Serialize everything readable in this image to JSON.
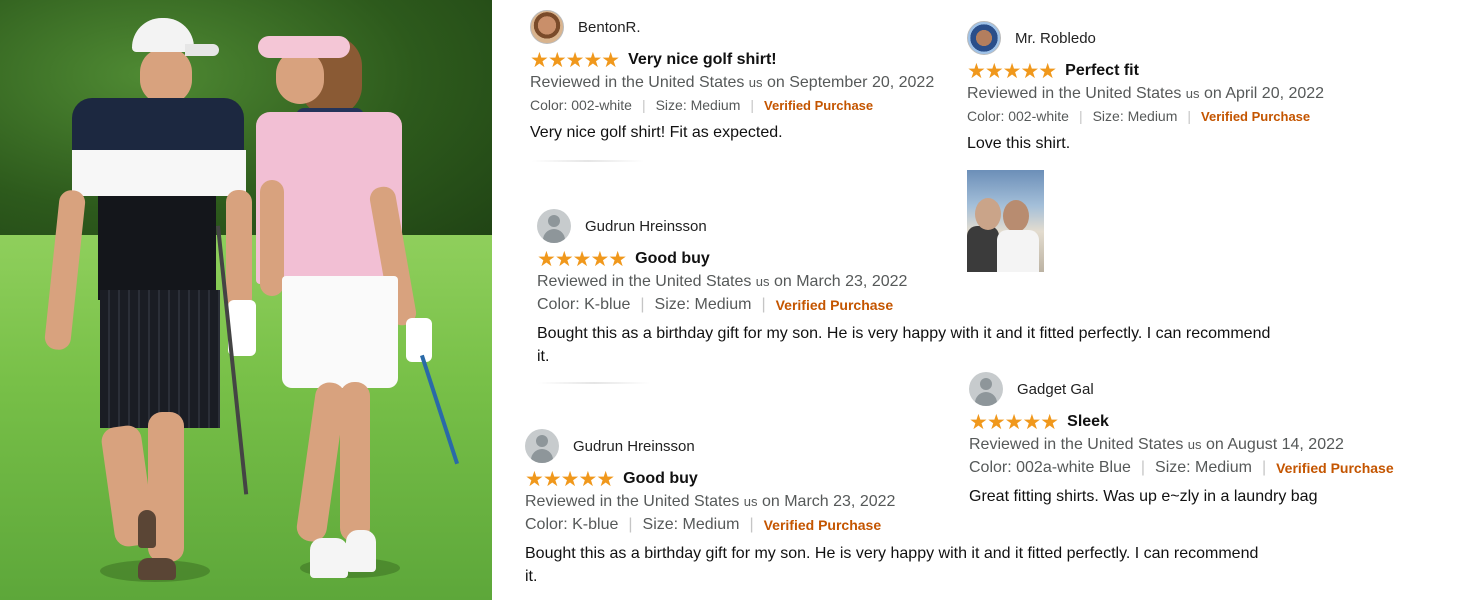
{
  "reviews": [
    {
      "reviewer": "BentonR.",
      "stars": "★★★★★",
      "title": "Very nice golf shirt!",
      "reviewed_prefix": "Reviewed in the United States",
      "flag": "us",
      "reviewed_date": "on September 20, 2022",
      "color": "Color: 002-white",
      "size": "Size: Medium",
      "verified": "Verified Purchase",
      "body": "Very nice golf shirt! Fit as expected."
    },
    {
      "reviewer": "Mr. Robledo",
      "stars": "★★★★★",
      "title": "Perfect fit",
      "reviewed_prefix": "Reviewed in the United States",
      "flag": "us",
      "reviewed_date": "on April 20, 2022",
      "color": "Color: 002-white",
      "size": "Size: Medium",
      "verified": "Verified Purchase",
      "body": "Love this shirt."
    },
    {
      "reviewer": "Gudrun Hreinsson",
      "stars": "★★★★★",
      "title": "Good buy",
      "reviewed_prefix": "Reviewed in the United States",
      "flag": "us",
      "reviewed_date": "on March 23, 2022",
      "color": "Color: K-blue",
      "size": "Size: Medium",
      "verified": "Verified Purchase",
      "body_line1": "Bought this as a birthday gift for my son. He is very happy with it and it fitted perfectly. I can recommend",
      "body_line2": "it."
    },
    {
      "reviewer": "Gadget Gal",
      "stars": "★★★★★",
      "title": "Sleek",
      "reviewed_prefix": "Reviewed in the United States",
      "flag": "us",
      "reviewed_date": "on August 14, 2022",
      "color": "Color: 002a-white Blue",
      "size": "Size: Medium",
      "verified": "Verified Purchase",
      "body": "Great fitting shirts. Was up e~zly in a laundry bag"
    },
    {
      "reviewer": "Gudrun Hreinsson",
      "stars": "★★★★★",
      "title": "Good buy",
      "reviewed_prefix": "Reviewed in the United States",
      "flag": "us",
      "reviewed_date": "on March 23, 2022",
      "color": "Color: K-blue",
      "size": "Size: Medium",
      "verified": "Verified Purchase",
      "body_line1": "Bought this as a birthday gift for my son. He is very happy with it and it fitted perfectly. I can recommend",
      "body_line2": "it."
    }
  ],
  "colors": {
    "star": "#f0981c",
    "verified": "#c45500",
    "meta": "#565959"
  }
}
